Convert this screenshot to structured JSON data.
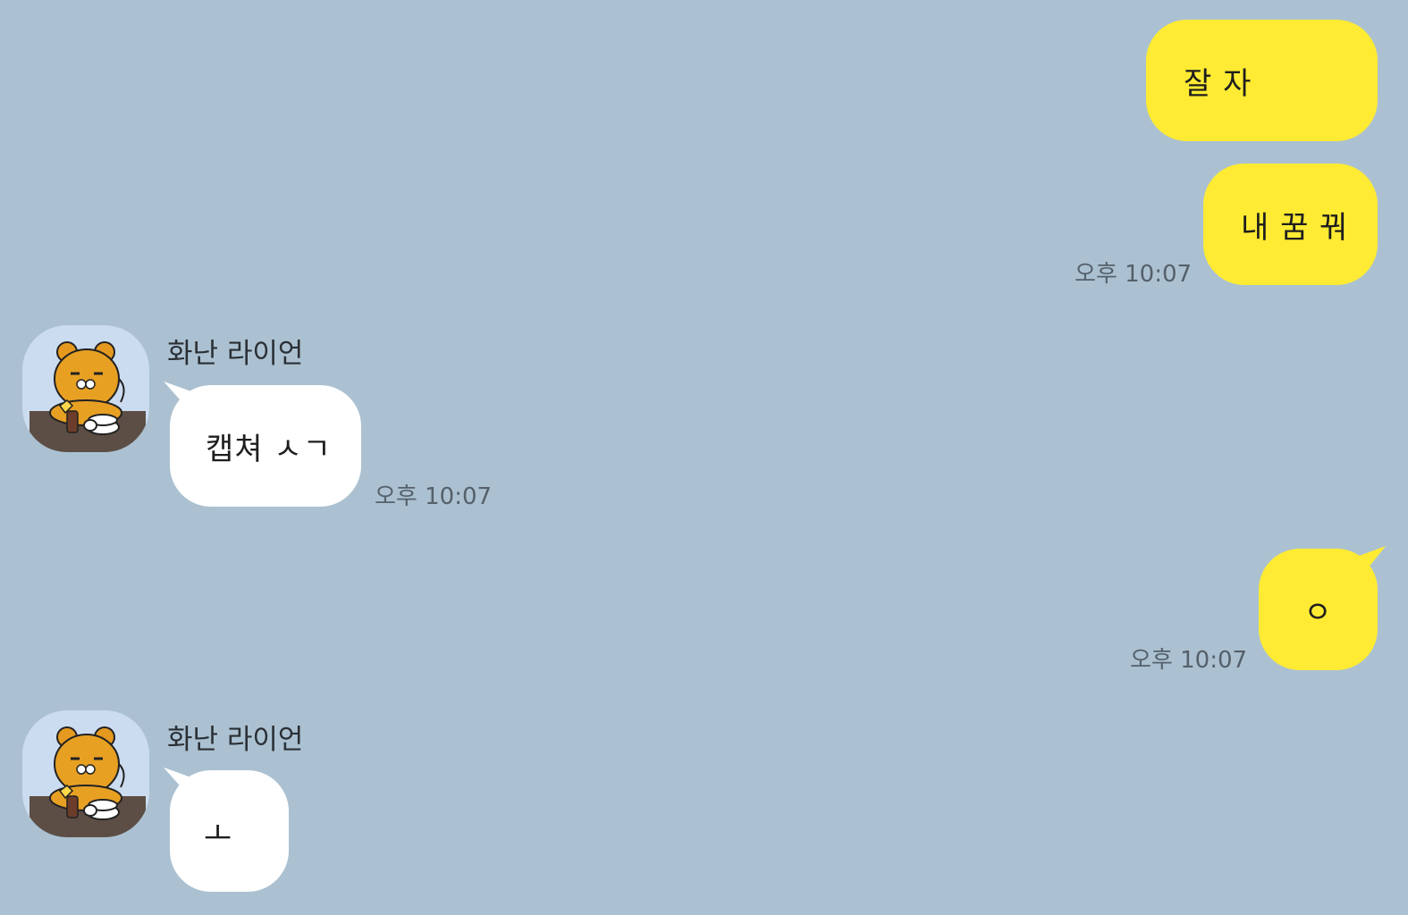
{
  "theme": {
    "background": "#abc1d1",
    "my_bubble": "#ffeb33",
    "their_bubble": "#ffffff",
    "time_color": "#55606b"
  },
  "messages": [
    {
      "sender": "me",
      "text": "잘 자"
    },
    {
      "sender": "me",
      "text": "내 꿈 꿔",
      "time": "오후 10:07"
    },
    {
      "sender": "화난 라이언",
      "avatar_icon": "ryan-avatar-icon",
      "text": "캡쳐 ㅅㄱ",
      "time": "오후 10:07"
    },
    {
      "sender": "me",
      "text": "ㅇ",
      "time": "오후 10:07"
    },
    {
      "sender": "화난 라이언",
      "avatar_icon": "ryan-avatar-icon",
      "text": "ㅗ"
    }
  ]
}
